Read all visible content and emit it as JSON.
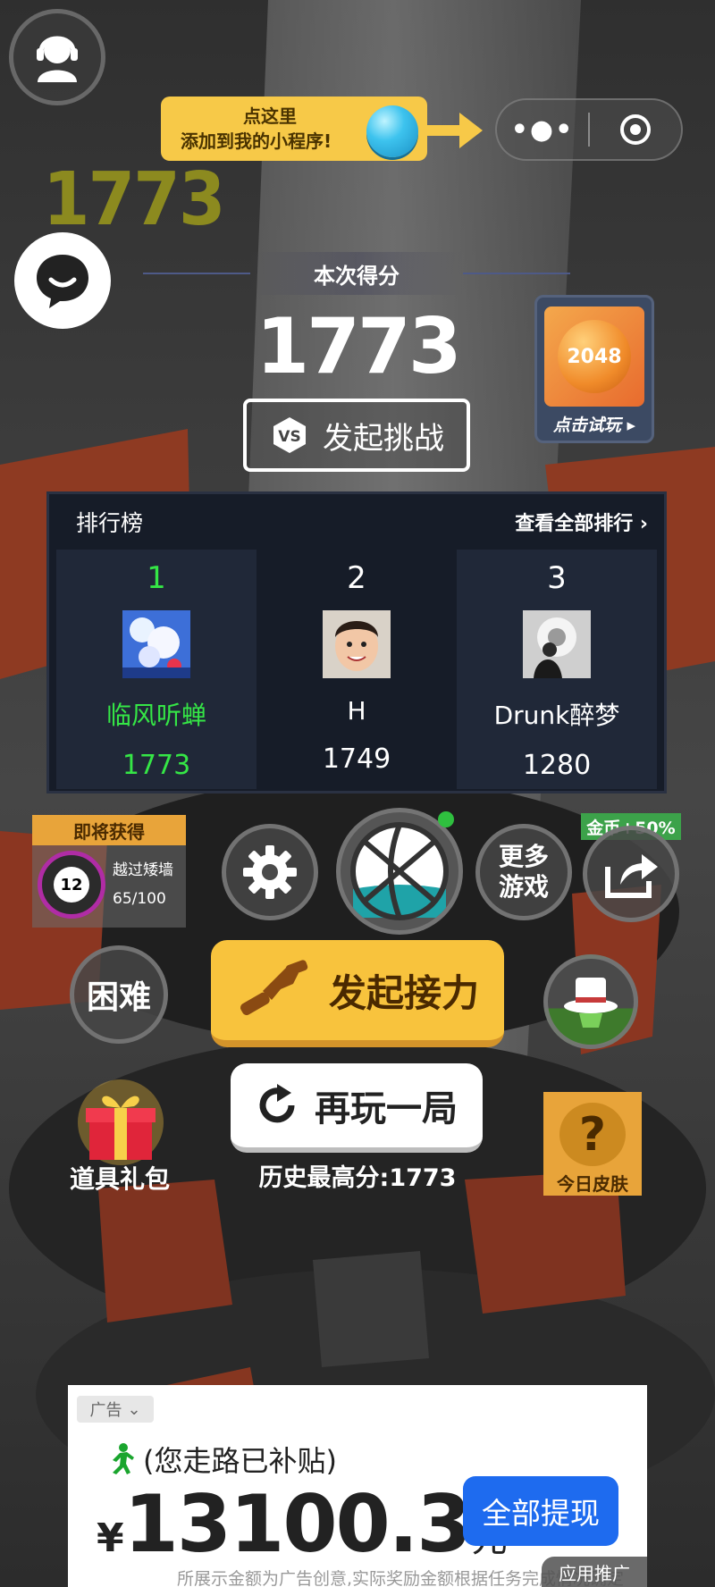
{
  "top": {
    "tooltip_line1": "点这里",
    "tooltip_line2": "添加到我的小程序!",
    "ghost_score": "1773"
  },
  "result": {
    "score_label": "本次得分",
    "score": "1773",
    "challenge_label": "发起挑战"
  },
  "promo_game": {
    "tile_text": "2048",
    "caption": "点击试玩 ▸"
  },
  "leaderboard": {
    "title": "排行榜",
    "view_all": "查看全部排行 ›",
    "entries": [
      {
        "rank": "1",
        "name": "临风听蝉",
        "score": "1773"
      },
      {
        "rank": "2",
        "name": "H",
        "score": "1749"
      },
      {
        "rank": "3",
        "name": "Drunk醉梦",
        "score": "1280"
      }
    ]
  },
  "upcoming": {
    "header": "即将获得",
    "ball_number": "12",
    "desc": "越过矮墙",
    "progress": "65/100"
  },
  "buttons": {
    "more_games_line1": "更多",
    "more_games_line2": "游戏",
    "coin_bonus": "金币+50%",
    "difficulty": "困难",
    "relay": "发起接力",
    "play_again": "再玩一局",
    "best_score": "历史最高分:1773",
    "gift": "道具礼包",
    "today_skin": "今日皮肤",
    "skin_symbol": "?"
  },
  "ad": {
    "tag": "广告",
    "subsidy": "(您走路已补贴)",
    "currency": "¥",
    "amount": "13100.3",
    "unit": "元",
    "withdraw": "全部提现",
    "disclaimer": "所展示金额为广告创意,实际奖励金额根据任务完成情况确定",
    "app_promo": "应用推广"
  },
  "colors": {
    "accent_yellow": "#f8c33d",
    "leader_green": "#35e646",
    "ad_blue": "#1e6bef",
    "ghost_olive": "#8c8a1f"
  }
}
